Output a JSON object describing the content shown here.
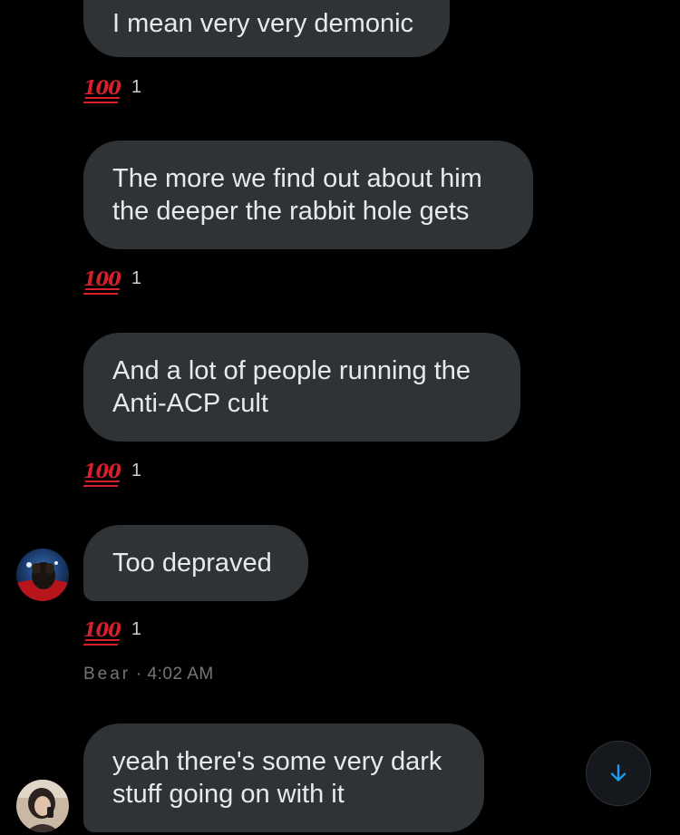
{
  "messages": [
    {
      "text": "I mean very very demonic",
      "reaction": {
        "emoji": "100",
        "count": "1"
      }
    },
    {
      "text": "The more we find out about him\nthe deeper the rabbit hole gets",
      "reaction": {
        "emoji": "100",
        "count": "1"
      }
    },
    {
      "text": "And a lot of people running the\nAnti-ACP cult",
      "reaction": {
        "emoji": "100",
        "count": "1"
      }
    },
    {
      "text": "Too depraved",
      "reaction": {
        "emoji": "100",
        "count": "1"
      }
    },
    {
      "text": "yeah there's some very dark\nstuff going on with it"
    }
  ],
  "meta": {
    "sender": "Bear",
    "separator": " · ",
    "time": "4:02 AM"
  },
  "icons": {
    "scroll_down": "arrow-down-icon",
    "reaction": "hundred-points-icon"
  },
  "colors": {
    "bubble": "#2f3336",
    "background": "#000000",
    "accent": "#1d9bf0",
    "reaction": "#d8202c"
  }
}
